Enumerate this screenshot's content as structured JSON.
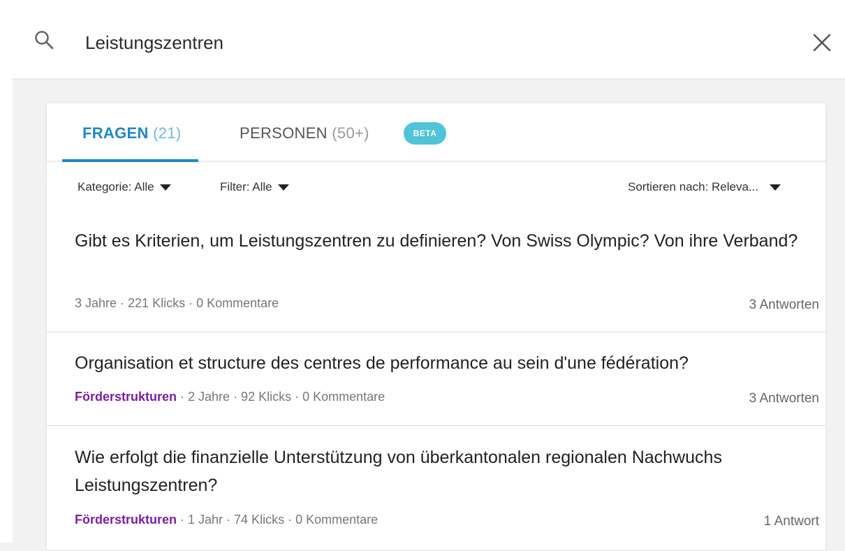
{
  "search": {
    "value": "Leistungszentren",
    "icon": "search-icon",
    "close_icon": "close-icon"
  },
  "tabs": [
    {
      "label": "FRAGEN",
      "count": "(21)",
      "active": true
    },
    {
      "label": "PERSONEN",
      "count": "(50+)",
      "active": false
    }
  ],
  "beta_badge": "BETA",
  "filters": {
    "kategorie": "Kategorie: Alle",
    "filter": "Filter: Alle",
    "sort": "Sortieren nach: Releva..."
  },
  "results": [
    {
      "title": "Gibt es Kriterien, um Leistungszentren zu definieren? Von Swiss Olympic? Von ihre Verband?",
      "category": "",
      "meta": "3 Jahre · 221 Klicks · 0 Kommentare",
      "answers": "3 Antworten"
    },
    {
      "title": "Organisation et structure des centres de performance au sein d'une fédération?",
      "category": "Förderstrukturen",
      "meta": " · 2 Jahre · 92 Klicks · 0 Kommentare",
      "answers": "3 Antworten"
    },
    {
      "title": "Wie erfolgt die finanzielle Unterstützung von überkantonalen regionalen Nachwuchs Leistungszentren?",
      "category": "Förderstrukturen",
      "meta": " · 1 Jahr · 74 Klicks · 0 Kommentare",
      "answers": "1 Antwort"
    }
  ],
  "colors": {
    "accent": "#1e88c7",
    "category": "#7b1fa2",
    "beta": "#4fc3d7"
  }
}
